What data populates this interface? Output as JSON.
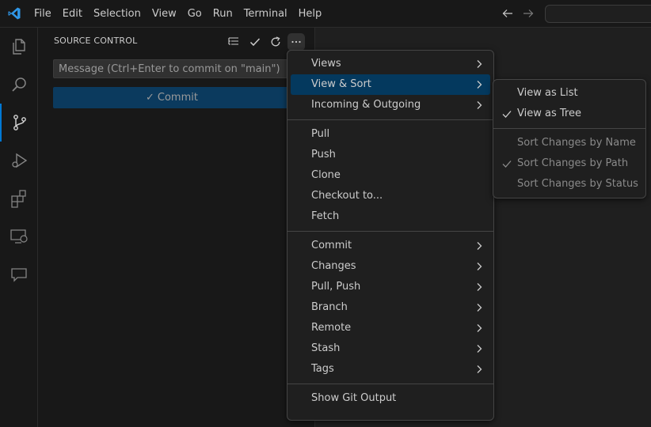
{
  "menubar": [
    "File",
    "Edit",
    "Selection",
    "View",
    "Go",
    "Run",
    "Terminal",
    "Help"
  ],
  "sidebar": {
    "title": "SOURCE CONTROL",
    "message_placeholder": "Message (Ctrl+Enter to commit on \"main\")",
    "commit_label": "Commit"
  },
  "context_menu": {
    "groups": [
      [
        {
          "label": "Views",
          "submenu": true
        },
        {
          "label": "View & Sort",
          "submenu": true,
          "selected": true
        },
        {
          "label": "Incoming & Outgoing",
          "submenu": true
        }
      ],
      [
        {
          "label": "Pull"
        },
        {
          "label": "Push"
        },
        {
          "label": "Clone"
        },
        {
          "label": "Checkout to..."
        },
        {
          "label": "Fetch"
        }
      ],
      [
        {
          "label": "Commit",
          "submenu": true
        },
        {
          "label": "Changes",
          "submenu": true
        },
        {
          "label": "Pull, Push",
          "submenu": true
        },
        {
          "label": "Branch",
          "submenu": true
        },
        {
          "label": "Remote",
          "submenu": true
        },
        {
          "label": "Stash",
          "submenu": true
        },
        {
          "label": "Tags",
          "submenu": true
        }
      ],
      [
        {
          "label": "Show Git Output"
        }
      ]
    ]
  },
  "view_sort_submenu": {
    "groups": [
      [
        {
          "label": "View as List",
          "checked": false,
          "disabled": false
        },
        {
          "label": "View as Tree",
          "checked": true,
          "disabled": false
        }
      ],
      [
        {
          "label": "Sort Changes by Name",
          "checked": false,
          "disabled": true
        },
        {
          "label": "Sort Changes by Path",
          "checked": true,
          "disabled": true
        },
        {
          "label": "Sort Changes by Status",
          "checked": false,
          "disabled": true
        }
      ]
    ]
  },
  "colors": {
    "accent": "#0078d4",
    "selection": "#04395e",
    "commit_button": "#0b3a5e"
  }
}
